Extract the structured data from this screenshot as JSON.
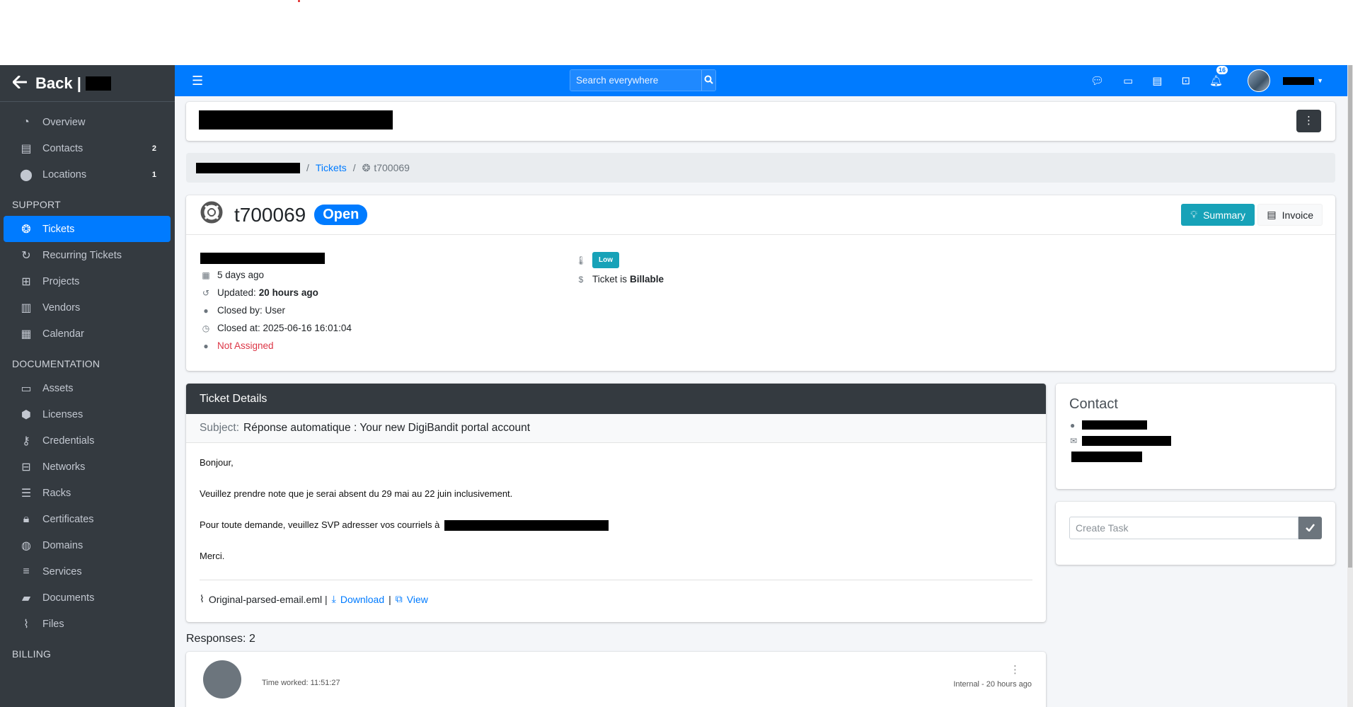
{
  "sidebar": {
    "back_label": "Back |",
    "items_main": [
      {
        "label": "Overview",
        "icon": "tachometer-icon",
        "badge": ""
      },
      {
        "label": "Contacts",
        "icon": "address-book-icon",
        "badge": "2"
      },
      {
        "label": "Locations",
        "icon": "map-marker-icon",
        "badge": "1"
      }
    ],
    "support_header": "SUPPORT",
    "items_support": [
      {
        "label": "Tickets",
        "icon": "life-ring-icon",
        "active": true
      },
      {
        "label": "Recurring Tickets",
        "icon": "redo-icon"
      },
      {
        "label": "Projects",
        "icon": "project-diagram-icon"
      },
      {
        "label": "Vendors",
        "icon": "building-icon"
      },
      {
        "label": "Calendar",
        "icon": "calendar-icon"
      }
    ],
    "documentation_header": "DOCUMENTATION",
    "items_docs": [
      {
        "label": "Assets",
        "icon": "desktop-icon"
      },
      {
        "label": "Licenses",
        "icon": "cube-icon"
      },
      {
        "label": "Credentials",
        "icon": "key-icon"
      },
      {
        "label": "Networks",
        "icon": "network-icon"
      },
      {
        "label": "Racks",
        "icon": "server-icon"
      },
      {
        "label": "Certificates",
        "icon": "lock-icon"
      },
      {
        "label": "Domains",
        "icon": "globe-icon"
      },
      {
        "label": "Services",
        "icon": "stream-icon"
      },
      {
        "label": "Documents",
        "icon": "folder-icon"
      },
      {
        "label": "Files",
        "icon": "paperclip-icon"
      }
    ],
    "billing_header": "BILLING"
  },
  "topnav": {
    "search_placeholder": "Search everywhere",
    "notification_count": "16"
  },
  "breadcrumb": {
    "tickets_link": "Tickets",
    "current": "t700069"
  },
  "ticket": {
    "number": "t700069",
    "status": "Open",
    "summary_button": "Summary",
    "invoice_button": "Invoice",
    "created": "5 days ago",
    "updated_label": "Updated:",
    "updated_value": "20 hours ago",
    "closed_by": "Closed by: User",
    "closed_at": "Closed at: 2025-06-16 16:01:04",
    "assignee": "Not Assigned",
    "priority": "Low",
    "billable_prefix": "Ticket is",
    "billable_value": "Billable"
  },
  "details": {
    "header": "Ticket Details",
    "subject_label": "Subject:",
    "subject": "Réponse automatique : Your new DigiBandit portal account",
    "body_line1": "Bonjour,",
    "body_line2": "Veuillez prendre note que je serai absent du 29 mai au 22 juin inclusivement.",
    "body_line3": "Pour toute demande, veuillez SVP adresser vos courriels à",
    "body_line4": "Merci.",
    "attachment_name": "Original-parsed-email.eml |",
    "download_label": "Download",
    "view_label": "View"
  },
  "contact": {
    "title": "Contact"
  },
  "task": {
    "placeholder": "Create Task"
  },
  "responses": {
    "title": "Responses: 2",
    "time_worked": "Time worked: 11:51:27",
    "meta": "Internal - 20 hours ago"
  },
  "colors": {
    "primary": "#007bff",
    "sidebar": "#343a40",
    "info": "#17a2b8",
    "danger": "#dc3545"
  }
}
